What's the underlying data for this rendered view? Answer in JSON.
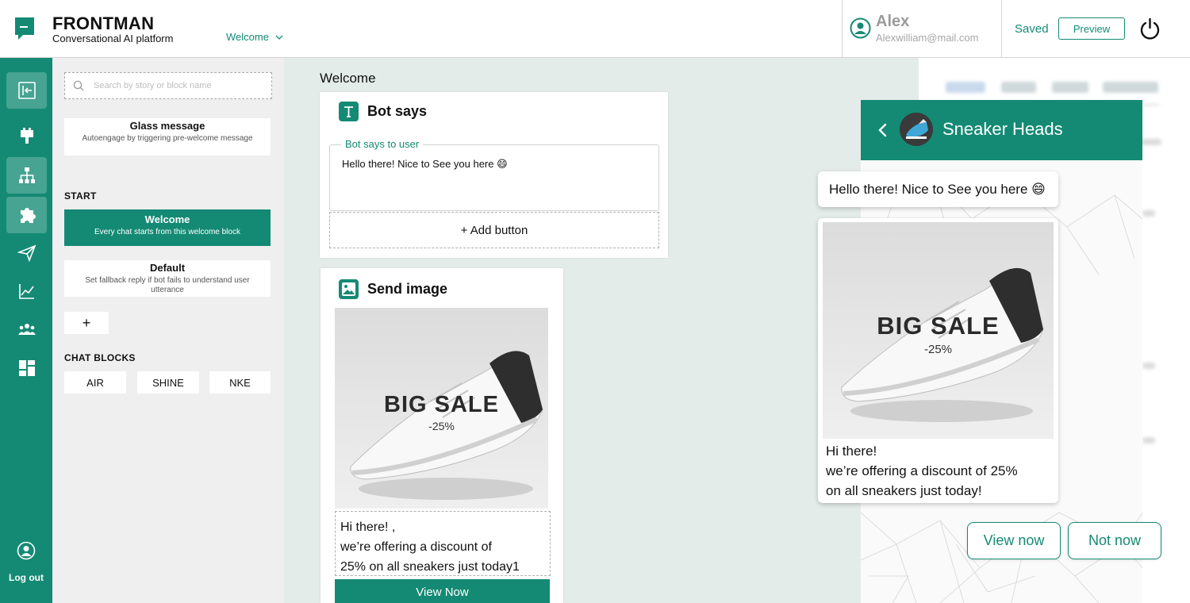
{
  "brand": {
    "name": "FRONTMAN",
    "subtitle": "Conversational AI platform"
  },
  "story_select": {
    "value": "Welcome"
  },
  "user": {
    "name": "Alex",
    "email": "Alexwilliam@mail.com"
  },
  "header_actions": {
    "saved_label": "Saved",
    "preview_label": "Preview"
  },
  "rail": {
    "items": [
      "collapse-icon",
      "plug-icon",
      "flow-tree-icon",
      "puzzle-icon",
      "send-icon",
      "analytics-icon",
      "team-icon",
      "dashboard-icon"
    ],
    "logout_label": "Log out"
  },
  "sidebar": {
    "search_placeholder": "Search by story or block name",
    "glass": {
      "title": "Glass message",
      "desc": "Autoengage by triggering pre-welcome message"
    },
    "start_label": "START",
    "welcome": {
      "title": "Welcome",
      "desc": "Every chat starts from this welcome block"
    },
    "default": {
      "title": "Default",
      "desc": "Set fallback reply if bot fails to understand user utterance"
    },
    "add_label": "+",
    "chat_blocks_label": "CHAT BLOCKS",
    "chat_blocks": [
      "AIR",
      "SHINE",
      "NKE"
    ]
  },
  "canvas": {
    "title": "Welcome",
    "bot_says": {
      "title": "Bot says",
      "field_label": "Bot says to user",
      "field_value": "Hello there! Nice to See you here 😄",
      "add_button": "+ Add button"
    },
    "send_image": {
      "title": "Send image",
      "sale_title": "BIG SALE",
      "sale_sub": "-25%",
      "caption_lines": [
        "Hi there! ,",
        "we’re offering a discount of",
        "25% on all sneakers just today1"
      ],
      "button_label": "View Now"
    }
  },
  "chat_preview": {
    "title": "Sneaker Heads",
    "greeting": "Hello there! Nice to See you here 😄",
    "sale_title": "BIG SALE",
    "sale_sub": "-25%",
    "caption_lines": [
      "Hi there!",
      "we’re offering a discount of 25%",
      "on all sneakers just today!"
    ],
    "quick_replies": [
      "View now",
      "Not now"
    ]
  },
  "colors": {
    "brand": "#148a74",
    "panel_bg": "#efefef",
    "canvas_bg": "#e4ecea"
  }
}
